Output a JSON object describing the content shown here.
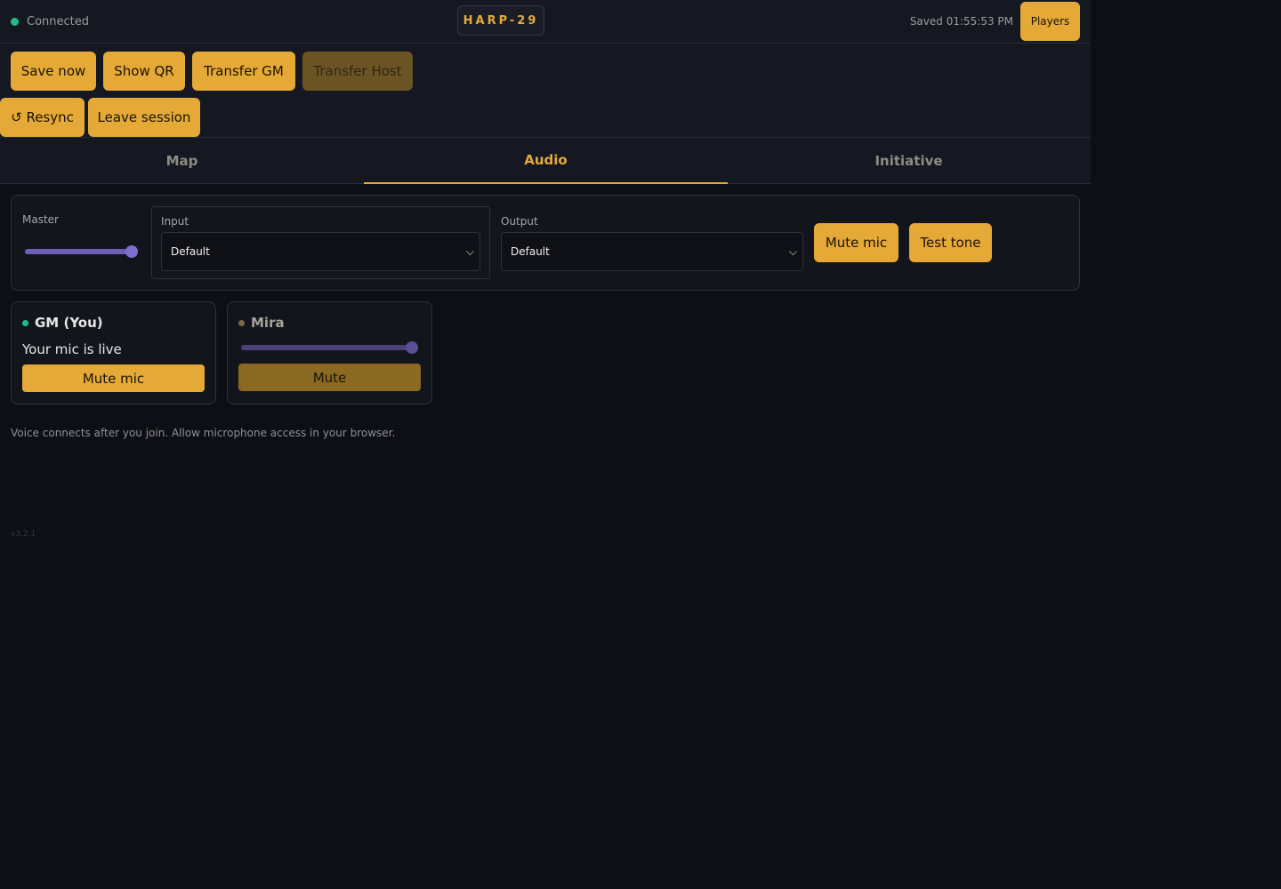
{
  "status": {
    "label": "Connected",
    "color": "#1fbf8a"
  },
  "room_code": "HARP-29",
  "saved_text": "Saved 01:55:53 PM",
  "players_label": "Players",
  "actions": {
    "save_now": "Save now",
    "show_qr": "Show QR",
    "transfer_gm": "Transfer GM",
    "transfer_host": "Transfer Host",
    "resync": "↺ Resync",
    "leave_session": "Leave session"
  },
  "tabs": [
    {
      "label": "Map",
      "active": false
    },
    {
      "label": "Audio",
      "active": true
    },
    {
      "label": "Initiative",
      "active": false
    }
  ],
  "audio": {
    "master_label": "Master",
    "master_level": 1.0,
    "input_label": "Input",
    "input_value": "Default",
    "output_label": "Output",
    "output_value": "Default",
    "mute_mic_label": "Mute mic",
    "test_tone_label": "Test tone"
  },
  "peers": [
    {
      "name": "GM (You)",
      "status_text": "Your mic is live",
      "button": "Mute mic",
      "dot_color": "#1fbf8a"
    },
    {
      "name": "Mira",
      "volume": 1.0,
      "button": "Mute",
      "dot_color": "#7a6a4a"
    }
  ],
  "note": "Voice connects after you join. Allow microphone access in your browser.",
  "version": "v3.2.1",
  "colors": {
    "accent": "#e5a937",
    "background": "#0e0f14",
    "panel": "#151821",
    "slider": "#6e5fb5"
  }
}
